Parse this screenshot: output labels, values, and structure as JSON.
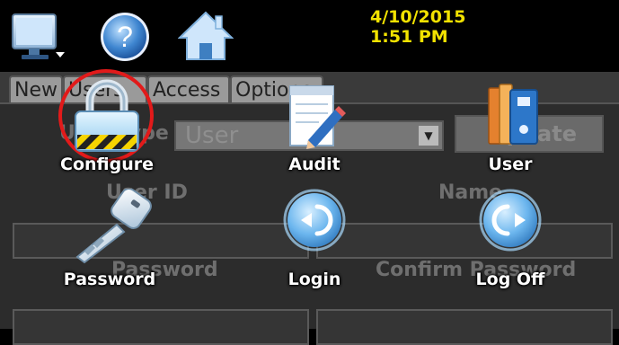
{
  "status": {
    "date": "4/10/2015",
    "time": "1:51 PM"
  },
  "tabs": [
    {
      "label": "New"
    },
    {
      "label": "Users"
    },
    {
      "label": "Access"
    },
    {
      "label": "Options"
    }
  ],
  "background_form": {
    "user_type_label": "User Type",
    "user_type_value": "User",
    "update_button": "Update",
    "user_id_label": "User ID",
    "name_label": "Name",
    "password_label": "Password",
    "confirm_password_label": "Confirm Password"
  },
  "menu": {
    "items": [
      {
        "label": "Configure",
        "icon": "padlock-icon"
      },
      {
        "label": "Audit",
        "icon": "notepad-pencil-icon"
      },
      {
        "label": "User",
        "icon": "binders-icon"
      },
      {
        "label": "Password",
        "icon": "key-icon"
      },
      {
        "label": "Login",
        "icon": "login-icon"
      },
      {
        "label": "Log Off",
        "icon": "logoff-icon"
      }
    ],
    "selected": "Configure",
    "highlight_color": "#e21a1a"
  },
  "colors": {
    "datetime": "#f2e200",
    "orb": "#4aa6e6"
  }
}
